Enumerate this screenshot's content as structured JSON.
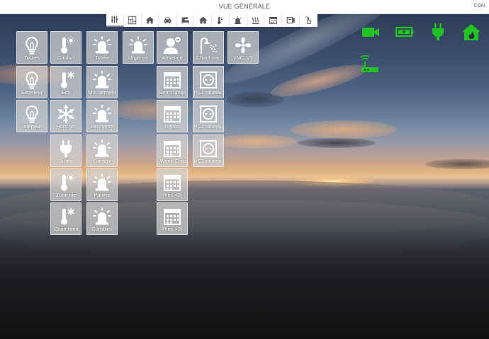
{
  "header": {
    "title": "VUE GÉNÉRALE",
    "right_text": "CON"
  },
  "tabs": [
    {
      "icon": "sliders-icon",
      "active": true
    },
    {
      "icon": "floor-plan-icon"
    },
    {
      "icon": "house-icon"
    },
    {
      "icon": "car-icon"
    },
    {
      "icon": "bed-icon"
    },
    {
      "icon": "house-icon"
    },
    {
      "icon": "thermometer-icon"
    },
    {
      "icon": "alarm-icon"
    },
    {
      "icon": "heating-icon"
    },
    {
      "icon": "calendar-icon"
    },
    {
      "icon": "outlet-panel-icon"
    },
    {
      "icon": "hand-switch-icon"
    }
  ],
  "tiles": {
    "toutes": "Toutes",
    "exterieur": "Extérieur",
    "interieur": "Intérieur",
    "confort": "Confort",
    "eco": "Eco",
    "hors_gel": "Hors gel",
    "arret": "Arrêt",
    "zone_vie": "Zone vie",
    "chambres": "Chambres",
    "totale": "Totale",
    "mouvement": "Mouvement",
    "perimetre": "Périmètre",
    "garage": "Garage",
    "paliers": "Paliers",
    "combles": "Combles",
    "urgence": "Urgence",
    "absence": "Absence",
    "sem_travail": "Sem travail",
    "repos": "Repos",
    "week_end": "Week End",
    "pres_lt2j": "Prés <2j",
    "pres_gt2j": "Prés >2j",
    "chauf_eau": "Chauf eau",
    "pc1": "PC1 tableau",
    "pc2": "PC2 tableau",
    "pc3": "PC3 tableau",
    "vmc": "VMC V1"
  },
  "status_icons": [
    "camera-icon",
    "battery-charging-icon",
    "power-plug-icon",
    "house-fire-icon",
    "wireless-router-icon"
  ],
  "colors": {
    "status_green": "#22c322",
    "tile_bg": "rgba(210,210,210,0.74)",
    "icon_white": "#ffffff"
  }
}
